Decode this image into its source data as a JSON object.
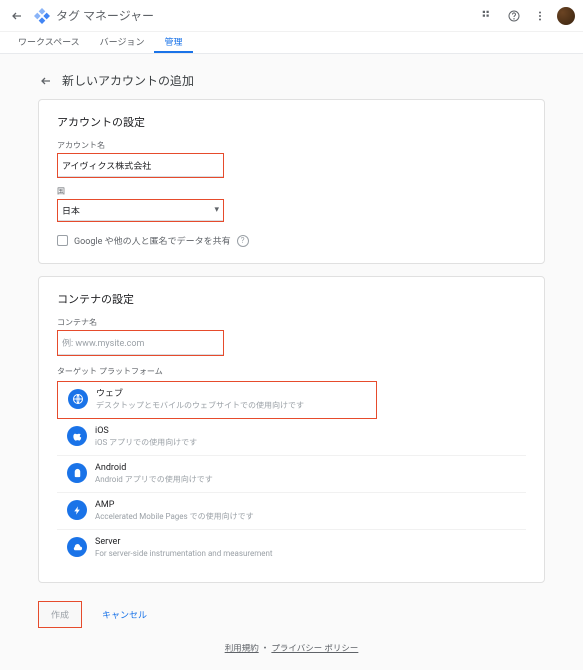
{
  "topbar": {
    "app_title": "タグ マネージャー"
  },
  "tabs": {
    "workspace": "ワークスペース",
    "version": "バージョン",
    "admin": "管理"
  },
  "page": {
    "title": "新しいアカウントの追加"
  },
  "account": {
    "section_title": "アカウントの設定",
    "name_label": "アカウント名",
    "name_value": "アイヴィクス株式会社",
    "country_label": "国",
    "country_value": "日本",
    "share_label": "Google や他の人と匿名でデータを共有"
  },
  "container": {
    "section_title": "コンテナの設定",
    "name_label": "コンテナ名",
    "name_placeholder": "例: www.mysite.com",
    "platform_label": "ターゲット プラットフォーム",
    "platforms": [
      {
        "name": "ウェブ",
        "desc": "デスクトップとモバイルのウェブサイトでの使用向けです"
      },
      {
        "name": "iOS",
        "desc": "iOS アプリでの使用向けです"
      },
      {
        "name": "Android",
        "desc": "Android アプリでの使用向けです"
      },
      {
        "name": "AMP",
        "desc": "Accelerated Mobile Pages での使用向けです"
      },
      {
        "name": "Server",
        "desc": "For server-side instrumentation and measurement"
      }
    ]
  },
  "buttons": {
    "create": "作成",
    "cancel": "キャンセル"
  },
  "footer": {
    "terms": "利用規約",
    "sep": "・",
    "privacy": "プライバシー ポリシー"
  }
}
